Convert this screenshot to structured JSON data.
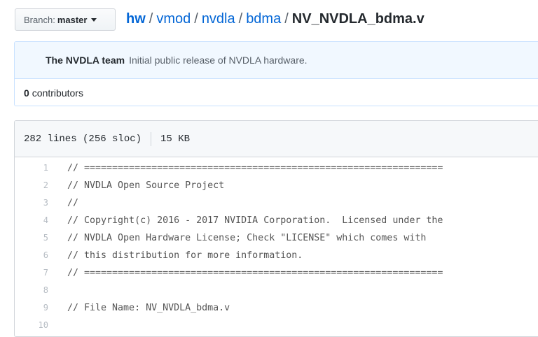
{
  "branch": {
    "label": "Branch:",
    "name": "master"
  },
  "breadcrumb": {
    "root": "hw",
    "separator": "/",
    "dirs": [
      "vmod",
      "nvdla",
      "bdma"
    ],
    "file": "NV_NVDLA_bdma.v"
  },
  "commit": {
    "author": "The NVDLA team",
    "message": "Initial public release of NVDLA hardware."
  },
  "contributors": {
    "count": "0",
    "label": "contributors"
  },
  "file_info": {
    "lines": "282 lines (256 sloc)",
    "size": "15 KB"
  },
  "code_lines": [
    {
      "num": "1",
      "text": "// ================================================================"
    },
    {
      "num": "2",
      "text": "// NVDLA Open Source Project"
    },
    {
      "num": "3",
      "text": "//"
    },
    {
      "num": "4",
      "text": "// Copyright(c) 2016 - 2017 NVIDIA Corporation.  Licensed under the"
    },
    {
      "num": "5",
      "text": "// NVDLA Open Hardware License; Check \"LICENSE\" which comes with"
    },
    {
      "num": "6",
      "text": "// this distribution for more information."
    },
    {
      "num": "7",
      "text": "// ================================================================"
    },
    {
      "num": "8",
      "text": ""
    },
    {
      "num": "9",
      "text": "// File Name: NV_NVDLA_bdma.v"
    },
    {
      "num": "10",
      "text": ""
    }
  ]
}
